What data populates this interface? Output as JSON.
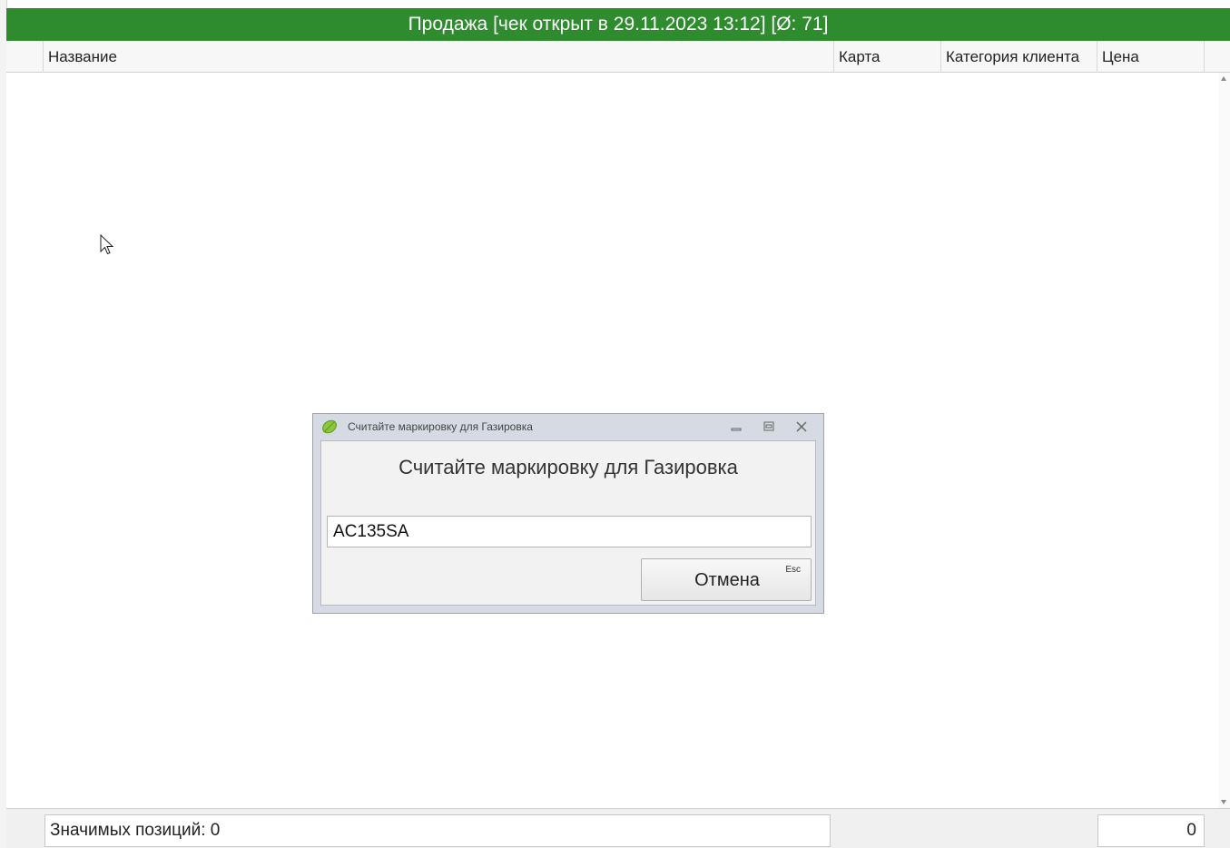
{
  "window": {
    "title": "Продажа [чек открыт в 29.11.2023 13:12] [Ø: 71]"
  },
  "grid": {
    "columns": [
      "Название",
      "Карта",
      "Категория клиента",
      "Цена"
    ],
    "rows": []
  },
  "footer": {
    "significant_positions": "Значимых позиций: 0",
    "total": "0"
  },
  "dialog": {
    "title": "Считайте маркировку для Газировка",
    "message": "Считайте маркировку для Газировка",
    "input_value": "AC135SA",
    "cancel_label": "Отмена",
    "cancel_shortcut": "Esc"
  },
  "colors": {
    "title_bar": "#2e8b2e",
    "title_text": "#ffffff",
    "dialog_frame": "#d6dbe3",
    "app_icon": "#8cc63f"
  },
  "icons": {
    "app": "leaf-icon",
    "minimize": "minimize-icon",
    "maximize": "maximize-icon",
    "close": "close-icon",
    "cursor": "mouse-cursor-icon"
  }
}
